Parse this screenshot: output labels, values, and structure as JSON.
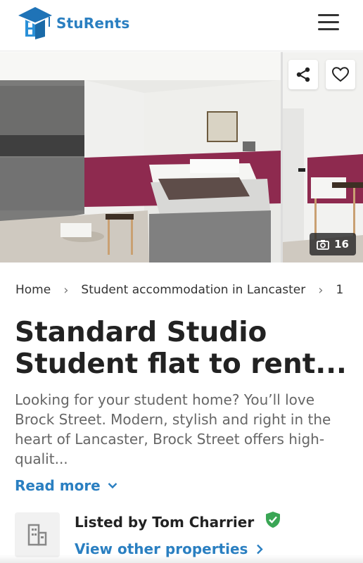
{
  "brand": {
    "name": "StuRents",
    "accent": "#2a7fc1"
  },
  "header": {
    "menu_icon": "hamburger-menu-icon"
  },
  "gallery": {
    "photo_count": "16",
    "share_icon": "share-icon",
    "favourite_icon": "heart-icon",
    "camera_icon": "camera-icon"
  },
  "breadcrumb": {
    "items": [
      "Home",
      "Student accommodation in Lancaster",
      "1"
    ],
    "separator_icon": "chevron-right-icon"
  },
  "listing": {
    "title": "Standard Studio Student flat to rent...",
    "description": "Looking for your student home? You’ll love Brock Street. Modern, stylish and right in the heart of Lancaster, Brock Street offers high-qualit...",
    "read_more": "Read more"
  },
  "agent": {
    "listed_by": "Listed by Tom Charrier",
    "view_properties": "View other properties",
    "avatar_icon": "building-icon",
    "verified_icon": "verified-shield-icon",
    "verified_color": "#3aa655"
  }
}
